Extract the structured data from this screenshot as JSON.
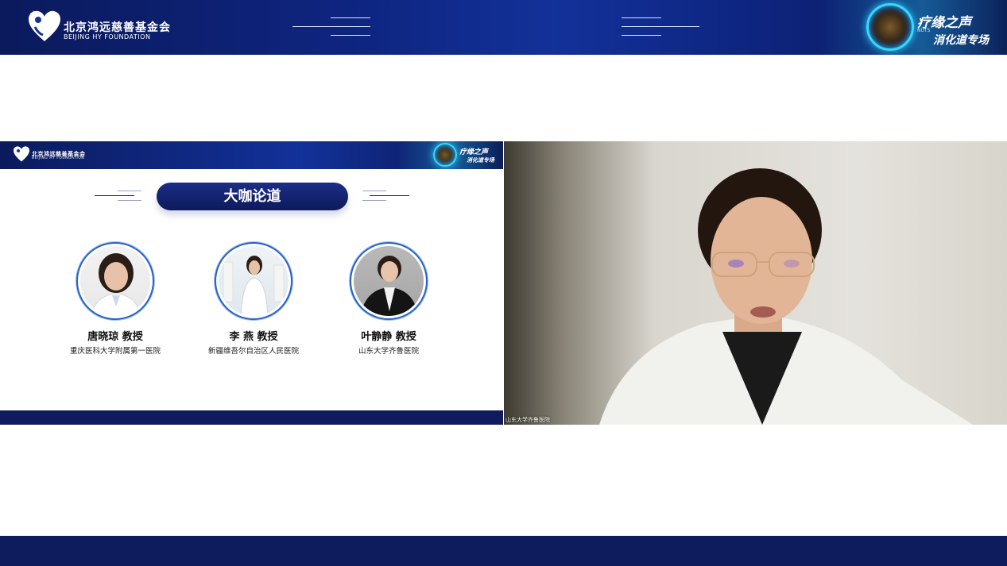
{
  "header": {
    "logo_cn": "北京鸿远慈善基金会",
    "logo_en": "BEIJING HY FOUNDATION",
    "brand_title": "疗缘之声",
    "brand_tiny": "NUTS",
    "brand_sub": "消化道专场"
  },
  "slide": {
    "title": "大咖论道",
    "experts": [
      {
        "name": "唐晓琼  教授",
        "hospital": "重庆医科大学附属第一医院"
      },
      {
        "name": "李  燕  教授",
        "hospital": "新疆维吾尔自治区人民医院"
      },
      {
        "name": "叶静静  教授",
        "hospital": "山东大学齐鲁医院"
      }
    ]
  },
  "video": {
    "participant_label": "山东大学齐鲁医院"
  },
  "colors": {
    "navy": "#0e1c5e",
    "accent_blue": "#123199",
    "glow_cyan": "#38d7ff"
  }
}
